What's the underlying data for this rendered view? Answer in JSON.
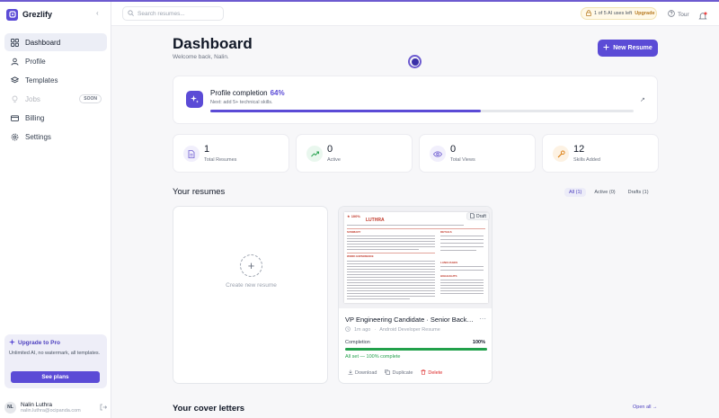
{
  "app": {
    "name": "Grezlify"
  },
  "sidebar": {
    "items": [
      {
        "label": "Dashboard",
        "icon": "grid-icon"
      },
      {
        "label": "Profile",
        "icon": "user-icon"
      },
      {
        "label": "Templates",
        "icon": "stack-icon"
      },
      {
        "label": "Jobs",
        "icon": "lightbulb-icon",
        "badge": "SOON"
      },
      {
        "label": "Billing",
        "icon": "card-icon"
      },
      {
        "label": "Settings",
        "icon": "gear-icon"
      }
    ],
    "upgrade": {
      "title": "Upgrade to Pro",
      "description": "Unlimited AI, no watermark, all templates.",
      "button": "See plans"
    },
    "user": {
      "initials": "NL",
      "name": "Nalin Luthra",
      "email": "nalin.luthra@ocipanda.com"
    }
  },
  "topbar": {
    "search_placeholder": "Search resumes...",
    "usage_text": "1 of 5 AI uses left",
    "upgrade_link": "Upgrade",
    "tour": "Tour"
  },
  "header": {
    "title": "Dashboard",
    "subtitle": "Welcome back, Nalin.",
    "new_button": "New Resume"
  },
  "profile_completion": {
    "title": "Profile completion",
    "percent_text": "64%",
    "percent": 64,
    "next": "Next: add 5+ technical skills."
  },
  "stats": [
    {
      "value": "1",
      "label": "Total Resumes",
      "icon": "document-icon",
      "color": "#6d5bd0",
      "bg": "#f1effc"
    },
    {
      "value": "0",
      "label": "Active",
      "icon": "trend-up-icon",
      "color": "#22a04b",
      "bg": "#e9f7ee"
    },
    {
      "value": "0",
      "label": "Total Views",
      "icon": "eye-icon",
      "color": "#6d5bd0",
      "bg": "#f1effc"
    },
    {
      "value": "12",
      "label": "Skills Added",
      "icon": "wrench-icon",
      "color": "#d97706",
      "bg": "#fdf2e3"
    }
  ],
  "resumes": {
    "title": "Your resumes",
    "filters": [
      "All (1)",
      "Active (0)",
      "Drafts (1)"
    ],
    "create_label": "Create new resume",
    "card": {
      "title": "VP Engineering Candidate · Senior Backe...",
      "time": "1m ago",
      "template": "Android Developer Resume",
      "status": "Draft",
      "completion_label": "Completion",
      "completion_text": "100%",
      "completion": 100,
      "note": "All set — 100% complete",
      "actions": [
        "Download",
        "Duplicate",
        "Delete"
      ],
      "preview": {
        "score": "★ 100%",
        "name": "LUTHRA",
        "summary": "SUMMARY",
        "experience": "WORK EXPERIENCE",
        "details": "DETAILS",
        "languages": "LANGUAGES",
        "highlights": "HIGHLIGHTS"
      }
    }
  },
  "cover_letters": {
    "title": "Your cover letters",
    "open_all": "Open all →"
  }
}
